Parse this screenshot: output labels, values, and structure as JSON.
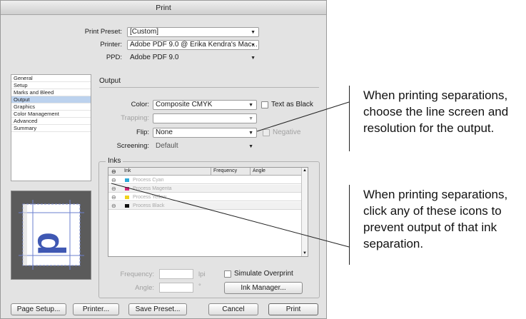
{
  "dialog": {
    "title": "Print",
    "print_preset": {
      "label": "Print Preset:",
      "value": "[Custom]"
    },
    "printer": {
      "label": "Printer:",
      "value": "Adobe PDF 9.0 @ Erika Kendra's Mac..."
    },
    "ppd": {
      "label": "PPD:",
      "value": "Adobe PDF 9.0"
    },
    "sidebar": {
      "items": [
        "General",
        "Setup",
        "Marks and Bleed",
        "Output",
        "Graphics",
        "Color Management",
        "Advanced",
        "Summary"
      ],
      "selected": "Output"
    },
    "output": {
      "section_title": "Output",
      "color": {
        "label": "Color:",
        "value": "Composite CMYK"
      },
      "text_as_black": "Text as Black",
      "trapping": {
        "label": "Trapping:",
        "value": ""
      },
      "flip": {
        "label": "Flip:",
        "value": "None"
      },
      "negative": "Negative",
      "screening": {
        "label": "Screening:",
        "value": "Default"
      }
    },
    "inks": {
      "section_title": "Inks",
      "columns": [
        "Ink",
        "Frequency",
        "Angle"
      ],
      "rows": [
        {
          "name": "Process Cyan",
          "color": "#2aa9d8"
        },
        {
          "name": "Process Magenta",
          "color": "#d6247a"
        },
        {
          "name": "Process Yellow",
          "color": "#f0d21c"
        },
        {
          "name": "Process Black",
          "color": "#111111"
        }
      ],
      "frequency_label": "Frequency:",
      "frequency_unit": "lpi",
      "angle_label": "Angle:",
      "angle_unit": "°",
      "simulate_overprint": "Simulate Overprint",
      "ink_manager": "Ink Manager..."
    },
    "buttons": {
      "page_setup": "Page Setup...",
      "printer": "Printer...",
      "save_preset": "Save Preset...",
      "cancel": "Cancel",
      "print": "Print"
    }
  },
  "annotations": [
    {
      "lines": [
        "When printing separations,",
        "choose the line screen and",
        "resolution for the output."
      ]
    },
    {
      "lines": [
        "When printing separations,",
        "click any of these icons to",
        "prevent output of that ink",
        "separation."
      ]
    }
  ]
}
